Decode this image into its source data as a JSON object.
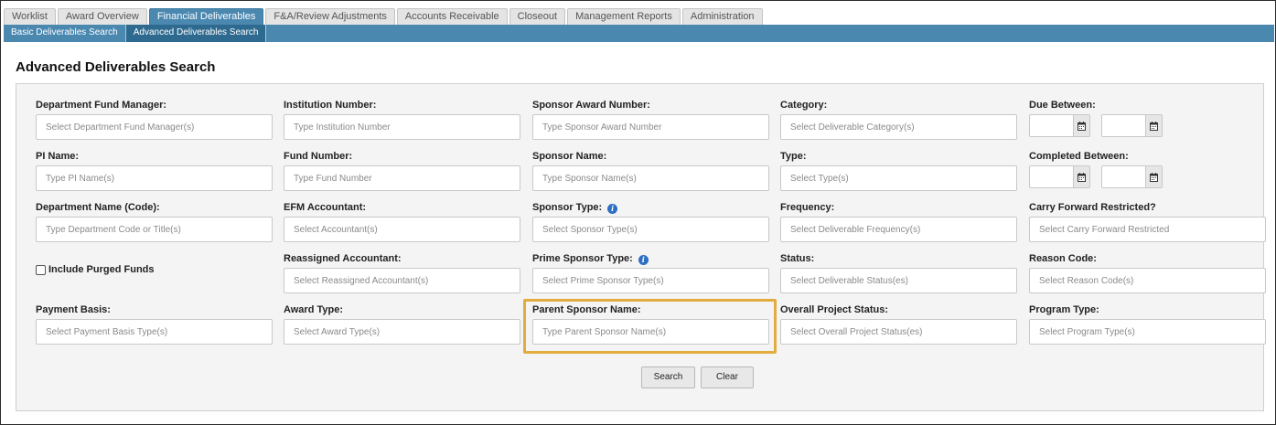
{
  "top_tabs": [
    "Worklist",
    "Award Overview",
    "Financial Deliverables",
    "F&A/Review Adjustments",
    "Accounts Receivable",
    "Closeout",
    "Management Reports",
    "Administration"
  ],
  "sub_tabs": [
    "Basic Deliverables Search",
    "Advanced Deliverables Search"
  ],
  "page_title": "Advanced Deliverables Search",
  "fields": {
    "dept_fund_manager": {
      "label": "Department Fund Manager:",
      "placeholder": "Select Department Fund Manager(s)"
    },
    "pi_name": {
      "label": "PI Name:",
      "placeholder": "Type PI Name(s)"
    },
    "dept_name": {
      "label": "Department Name (Code):",
      "placeholder": "Type Department Code or Title(s)"
    },
    "payment_basis": {
      "label": "Payment Basis:",
      "placeholder": "Select Payment Basis Type(s)"
    },
    "institution_number": {
      "label": "Institution Number:",
      "placeholder": "Type Institution Number"
    },
    "fund_number": {
      "label": "Fund Number:",
      "placeholder": "Type Fund Number"
    },
    "efm_accountant": {
      "label": "EFM Accountant:",
      "placeholder": "Select Accountant(s)"
    },
    "reassigned_accountant": {
      "label": "Reassigned Accountant:",
      "placeholder": "Select Reassigned Accountant(s)"
    },
    "award_type": {
      "label": "Award Type:",
      "placeholder": "Select Award Type(s)"
    },
    "sponsor_award_number": {
      "label": "Sponsor Award Number:",
      "placeholder": "Type Sponsor Award Number"
    },
    "sponsor_name": {
      "label": "Sponsor Name:",
      "placeholder": "Type Sponsor Name(s)"
    },
    "sponsor_type": {
      "label": "Sponsor Type:",
      "placeholder": "Select Sponsor Type(s)"
    },
    "prime_sponsor_type": {
      "label": "Prime Sponsor Type:",
      "placeholder": "Select Prime Sponsor Type(s)"
    },
    "parent_sponsor_name": {
      "label": "Parent Sponsor Name:",
      "placeholder": "Type Parent Sponsor Name(s)"
    },
    "category": {
      "label": "Category:",
      "placeholder": "Select Deliverable Category(s)"
    },
    "type": {
      "label": "Type:",
      "placeholder": "Select Type(s)"
    },
    "frequency": {
      "label": "Frequency:",
      "placeholder": "Select Deliverable Frequency(s)"
    },
    "status": {
      "label": "Status:",
      "placeholder": "Select Deliverable Status(es)"
    },
    "overall_project_status": {
      "label": "Overall Project Status:",
      "placeholder": "Select Overall Project Status(es)"
    },
    "due_between": {
      "label": "Due Between:"
    },
    "completed_between": {
      "label": "Completed Between:"
    },
    "carry_forward": {
      "label": "Carry Forward Restricted?",
      "placeholder": "Select Carry Forward Restricted"
    },
    "reason_code": {
      "label": "Reason Code:",
      "placeholder": "Select Reason Code(s)"
    },
    "program_type": {
      "label": "Program Type:",
      "placeholder": "Select Program Type(s)"
    }
  },
  "include_purged": {
    "label": "Include Purged Funds",
    "checked": false
  },
  "info_icon_glyph": "i",
  "buttons": {
    "search": "Search",
    "clear": "Clear"
  },
  "colors": {
    "nav_blue": "#4a88b0",
    "nav_active": "#2e6a90",
    "highlight": "#e2ac3e",
    "info_icon": "#2d6fc2"
  }
}
